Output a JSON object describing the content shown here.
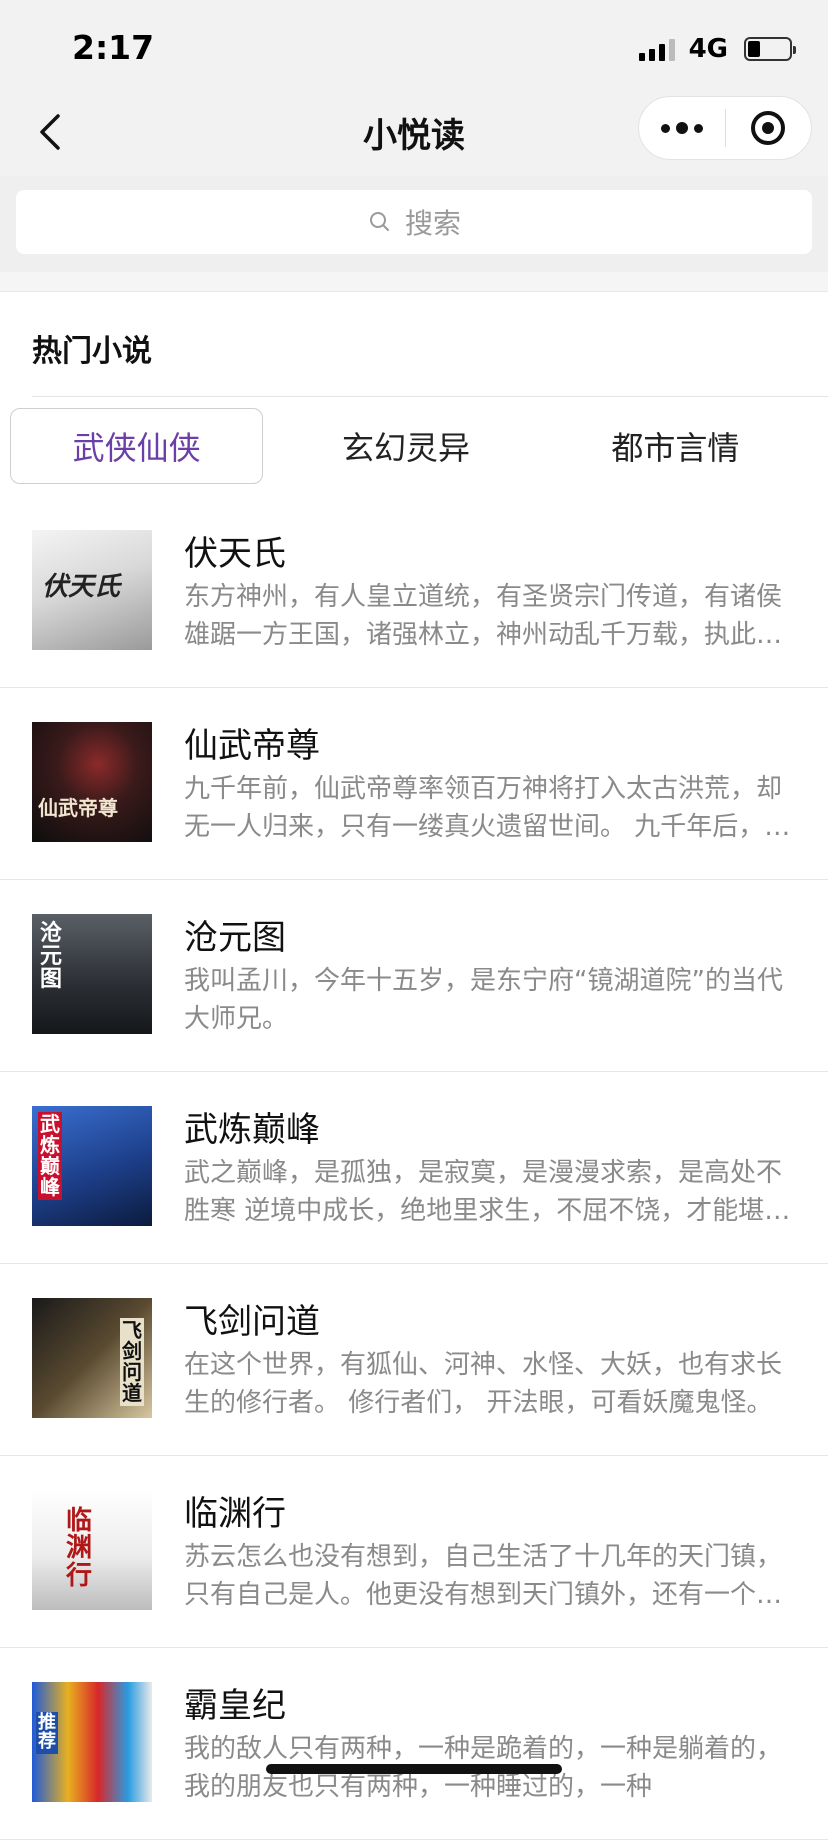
{
  "status_bar": {
    "time": "2:17",
    "network": "4G"
  },
  "nav": {
    "title": "小悦读",
    "icons": [
      "back-icon",
      "more-icon",
      "close-icon"
    ]
  },
  "search": {
    "placeholder": "搜索"
  },
  "section": {
    "title": "热门小说"
  },
  "tabs": [
    {
      "label": "武侠仙侠",
      "active": true
    },
    {
      "label": "玄幻灵异",
      "active": false
    },
    {
      "label": "都市言情",
      "active": false
    }
  ],
  "books": [
    {
      "title": "伏天氏",
      "desc": "东方神州，有人皇立道统，有圣贤宗门传道，有诸侯雄踞一方王国，诸强林立，神州动乱千万载，执此乱世者，谁能独尊天下？",
      "cover_text": "伏天氏"
    },
    {
      "title": "仙武帝尊",
      "desc": "九千年前，仙武帝尊率领百万神将打入太古洪荒，却无一人归来，只有一缕真火遗留世间。 九千年后，真火重现人间。",
      "cover_text": "仙武帝尊"
    },
    {
      "title": "沧元图",
      "desc": "我叫孟川，今年十五岁，是东宁府“镜湖道院”的当代大师兄。",
      "cover_text": "沧元图"
    },
    {
      "title": "武炼巅峰",
      "desc": "武之巅峰，是孤独，是寂寞，是漫漫求索，是高处不胜寒 逆境中成长，绝地里求生，不屈不饶，才能堪破武之极道。",
      "cover_text": "武炼巅峰"
    },
    {
      "title": "飞剑问道",
      "desc": "在这个世界，有狐仙、河神、水怪、大妖，也有求长生的修行者。 修行者们， 开法眼，可看妖魔鬼怪。",
      "cover_text": "飞剑问道"
    },
    {
      "title": "临渊行",
      "desc": "苏云怎么也没有想到，自己生活了十几年的天门镇，只有自己是人。他更没有想到天门镇外，还有一个更大的世界。",
      "cover_text": "临渊行"
    },
    {
      "title": "霸皇纪",
      "desc": "我的敌人只有两种，一种是跪着的，一种是躺着的，我的朋友也只有两种，一种睡过的，一种",
      "cover_text": "推荐"
    }
  ],
  "colors": {
    "accent": "#6b3fa8",
    "text_secondary": "#8a8a8a",
    "header_bg": "#f2f2f2"
  }
}
